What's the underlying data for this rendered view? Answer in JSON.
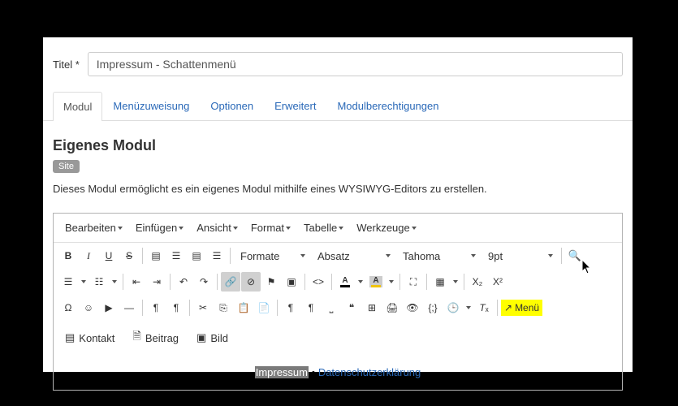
{
  "titleField": {
    "label": "Titel *",
    "value": "Impressum - Schattenmenü"
  },
  "tabs": [
    {
      "id": "modul",
      "label": "Modul",
      "active": true
    },
    {
      "id": "menuezuweisung",
      "label": "Menüzuweisung"
    },
    {
      "id": "optionen",
      "label": "Optionen"
    },
    {
      "id": "erweitert",
      "label": "Erweitert"
    },
    {
      "id": "modulberechtigungen",
      "label": "Modulberechtigungen"
    }
  ],
  "module": {
    "heading": "Eigenes Modul",
    "siteBadge": "Site",
    "description": "Dieses Modul ermöglicht es ein eigenes Modul mithilfe eines WYSIWYG-Editors zu erstellen."
  },
  "editorMenus": [
    "Bearbeiten",
    "Einfügen",
    "Ansicht",
    "Format",
    "Tabelle",
    "Werkzeuge"
  ],
  "toolbar": {
    "formate": "Formate",
    "absatz": "Absatz",
    "font": "Tahoma",
    "size": "9pt",
    "textColor": "#000000",
    "bgColor": "#f1c40f",
    "menuHighlight": "Menü"
  },
  "attachButtons": [
    {
      "id": "kontakt",
      "label": "Kontakt",
      "icon": "address-book"
    },
    {
      "id": "beitrag",
      "label": "Beitrag",
      "icon": "document"
    },
    {
      "id": "bild",
      "label": "Bild",
      "icon": "image"
    }
  ],
  "content": {
    "selected": "Impressum",
    "divider": "•",
    "link": "Datenschutzerklärung"
  }
}
